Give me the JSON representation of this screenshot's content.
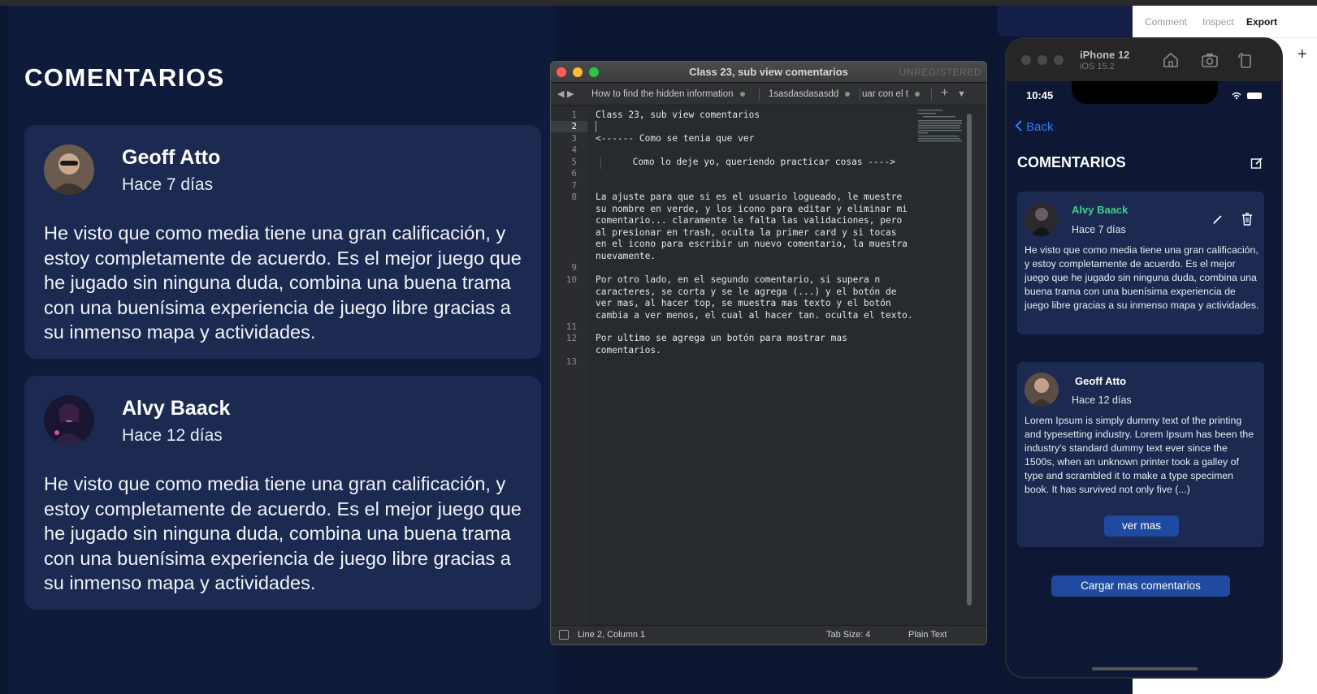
{
  "design": {
    "title": "COMENTARIOS",
    "cards": [
      {
        "name": "Geoff Atto",
        "time": "Hace 7 días",
        "body": "He visto que como media tiene una gran calificación, y estoy completamente de acuerdo. Es el mejor juego que he jugado sin ninguna duda, combina una buena trama con una buenísima experiencia de juego libre gracias a su inmenso mapa y actividades."
      },
      {
        "name": "Alvy Baack",
        "time": "Hace 12 días",
        "body": "He visto que como media tiene una gran calificación, y estoy completamente de acuerdo. Es el mejor juego que he jugado sin ninguna duda, combina una buena trama con una buenísima experiencia de juego libre gracias a su inmenso mapa y actividades."
      }
    ]
  },
  "editor": {
    "title": "Class 23, sub view comentarios",
    "unregistered": "UNREGISTERED",
    "tabs": [
      "How to find the hidden information",
      "1sasdasdasasdd",
      "uar con el t"
    ],
    "line_numbers": [
      "1",
      "2",
      "3",
      "4",
      "5",
      "6",
      "7",
      "8",
      "9",
      "10",
      "11",
      "12",
      "13"
    ],
    "lines": [
      "Class 23, sub view comentarios",
      "",
      "<------ Como se tenia que ver",
      "",
      "     Como lo deje yo, queriendo practicar cosas ---->",
      "",
      "",
      "La ajuste para que si es el usuario logueado, le muestre\nsu nombre en verde, y los icono para editar y eliminar mi\ncomentario... claramente le falta las validaciones, pero\nal presionar en trash, oculta la primer card y si tocas\nen el icono para escribir un nuevo comentario, la muestra\nnuevamente.",
      "",
      "Por otro lado, en el segundo comentario, si supera n\ncaracteres, se corta y se le agrega (...) y el botón de\nver mas, al hacer top, se muestra mas texto y el botón\ncambia a ver menos, el cual al hacer tan. oculta el texto.",
      "",
      "Por ultimo se agrega un botón para mostrar mas\ncomentarios.",
      ""
    ],
    "status": {
      "position": "Line 2, Column 1",
      "tab_size": "Tab Size: 4",
      "syntax": "Plain Text"
    }
  },
  "inspector": {
    "tabs": [
      "Comment",
      "Inspect",
      "Export"
    ],
    "active_tab": "Export"
  },
  "simulator": {
    "device": "iPhone 12",
    "os": "iOS 15.2",
    "clock": "10:45",
    "back_label": "Back",
    "title": "COMENTARIOS",
    "comments": [
      {
        "name": "Alvy Baack",
        "time": "Hace 7 días",
        "body": "He visto que como media tiene una gran calificación, y estoy completamente de acuerdo. Es el mejor juego que he jugado sin ninguna duda, combina una buena trama con una buenísima experiencia de juego libre gracias a su inmenso mapa y actividades."
      },
      {
        "name": "Geoff Atto",
        "time": "Hace 12 días",
        "body": "Lorem Ipsum is simply dummy text of the printing and typesetting industry. Lorem Ipsum has been the industry's standard dummy text ever since the 1500s, when an unknown printer took a galley of type and scrambled it to make a type specimen book. It has survived not only five (...)",
        "button": "ver mas"
      }
    ],
    "load_more": "Cargar mas comentarios"
  },
  "colors": {
    "background": "#0d1630",
    "card": "#1c2a52",
    "accent_blue": "#1f4aa0",
    "link_blue": "#2f7ef6",
    "owner_green": "#3ecf8e"
  }
}
